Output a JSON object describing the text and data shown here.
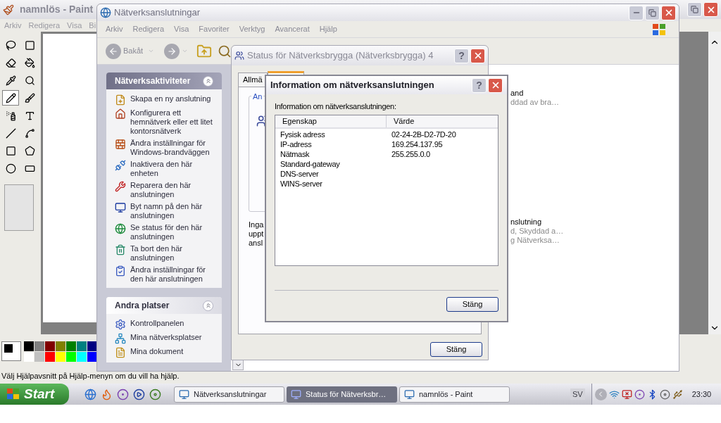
{
  "paint": {
    "title": "namnlös - Paint",
    "menu": [
      "Arkiv",
      "Redigera",
      "Visa",
      "Bi"
    ],
    "tools": [
      {
        "kind": "free-select",
        "selected": false
      },
      {
        "kind": "select",
        "selected": false
      },
      {
        "kind": "eraser",
        "selected": false
      },
      {
        "kind": "fill",
        "selected": false
      },
      {
        "kind": "picker",
        "selected": false
      },
      {
        "kind": "magnifier",
        "selected": false
      },
      {
        "kind": "pencil",
        "selected": true
      },
      {
        "kind": "brush",
        "selected": false
      },
      {
        "kind": "airbrush",
        "selected": false
      },
      {
        "kind": "text",
        "selected": false
      },
      {
        "kind": "line",
        "selected": false
      },
      {
        "kind": "curve",
        "selected": false
      },
      {
        "kind": "rectangle",
        "selected": false
      },
      {
        "kind": "polygon",
        "selected": false
      },
      {
        "kind": "ellipse",
        "selected": false
      },
      {
        "kind": "rounded-rectangle",
        "selected": false
      }
    ],
    "palette_top": [
      {
        "color": "#000000"
      },
      {
        "color": "#808080"
      },
      {
        "color": "#800000"
      },
      {
        "color": "#808000"
      },
      {
        "color": "#008000"
      },
      {
        "color": "#008080"
      },
      {
        "color": "#000080"
      }
    ],
    "palette_bottom": [
      {
        "color": "#ffffff"
      },
      {
        "color": "#c0c0c0"
      },
      {
        "color": "#ff0000"
      },
      {
        "color": "#ffff00"
      },
      {
        "color": "#00ff00"
      },
      {
        "color": "#00ffff"
      },
      {
        "color": "#0000ff"
      }
    ],
    "status": "Välj Hjälpavsnitt på Hjälp-menyn om du vill ha hjälp."
  },
  "network_window": {
    "title": "Nätverksanslutningar",
    "menu": [
      "Arkiv",
      "Redigera",
      "Visa",
      "Favoriter",
      "Verktyg",
      "Avancerat",
      "Hjälp"
    ],
    "back": "Bakåt",
    "tasks": {
      "title": "Nätverksaktiviteter",
      "expanded": true,
      "items": [
        "Skapa en ny anslutning",
        "Konfigurera ett hemnätverk eller ett litet kontorsnätverk",
        "Ändra inställningar för Windows-brandväggen",
        "Inaktivera den här enheten",
        "Reparera den här anslutningen",
        "Byt namn på den här anslutningen",
        "Se status för den här anslutningen",
        "Ta bort den här anslutningen",
        "Ändra inställningar för den här anslutningen"
      ]
    },
    "places": {
      "title": "Andra platser",
      "expanded": true,
      "items": [
        "Kontrollpanelen",
        "Mina nätverksplatser",
        "Mina dokument"
      ]
    },
    "connections": [
      {
        "name": "and",
        "details": [
          "ddad av bra…"
        ]
      },
      {
        "name": "nslutning",
        "details": [
          "d, Skyddad a…",
          "g Nätverksa…"
        ]
      }
    ]
  },
  "status_dialog": {
    "title": "Status för Nätverksbrygga (Nätverksbrygga) 4",
    "help": "?",
    "tabs": [
      {
        "label": "Allmä",
        "selected": false
      },
      {
        "selected": true
      }
    ],
    "group_label": "An",
    "text_lines": [
      "Inga",
      "uppt",
      "ansl"
    ],
    "close": "Stäng"
  },
  "info_dialog": {
    "title": "Information om nätverksanslutningen",
    "help": "?",
    "label": "Information om nätverksanslutningen:",
    "columns": [
      "Egenskap",
      "Värde"
    ],
    "rows": [
      [
        "Fysisk adress",
        "02-24-2B-D2-7D-20"
      ],
      [
        "IP-adress",
        "169.254.137.95"
      ],
      [
        "Nätmask",
        "255.255.0.0"
      ],
      [
        "Standard-gateway"
      ],
      [
        "DNS-server"
      ],
      [
        "WINS-server"
      ]
    ],
    "close": "Stäng"
  },
  "taskbar": {
    "start": "Start",
    "tasks": [
      {
        "label": "Nätverksanslutningar",
        "selected": false
      },
      {
        "label": "Status för Nätverksbr…",
        "selected": true
      },
      {
        "label": "namnlös - Paint",
        "selected": false
      }
    ],
    "language": "SV",
    "clock": "23:30"
  }
}
